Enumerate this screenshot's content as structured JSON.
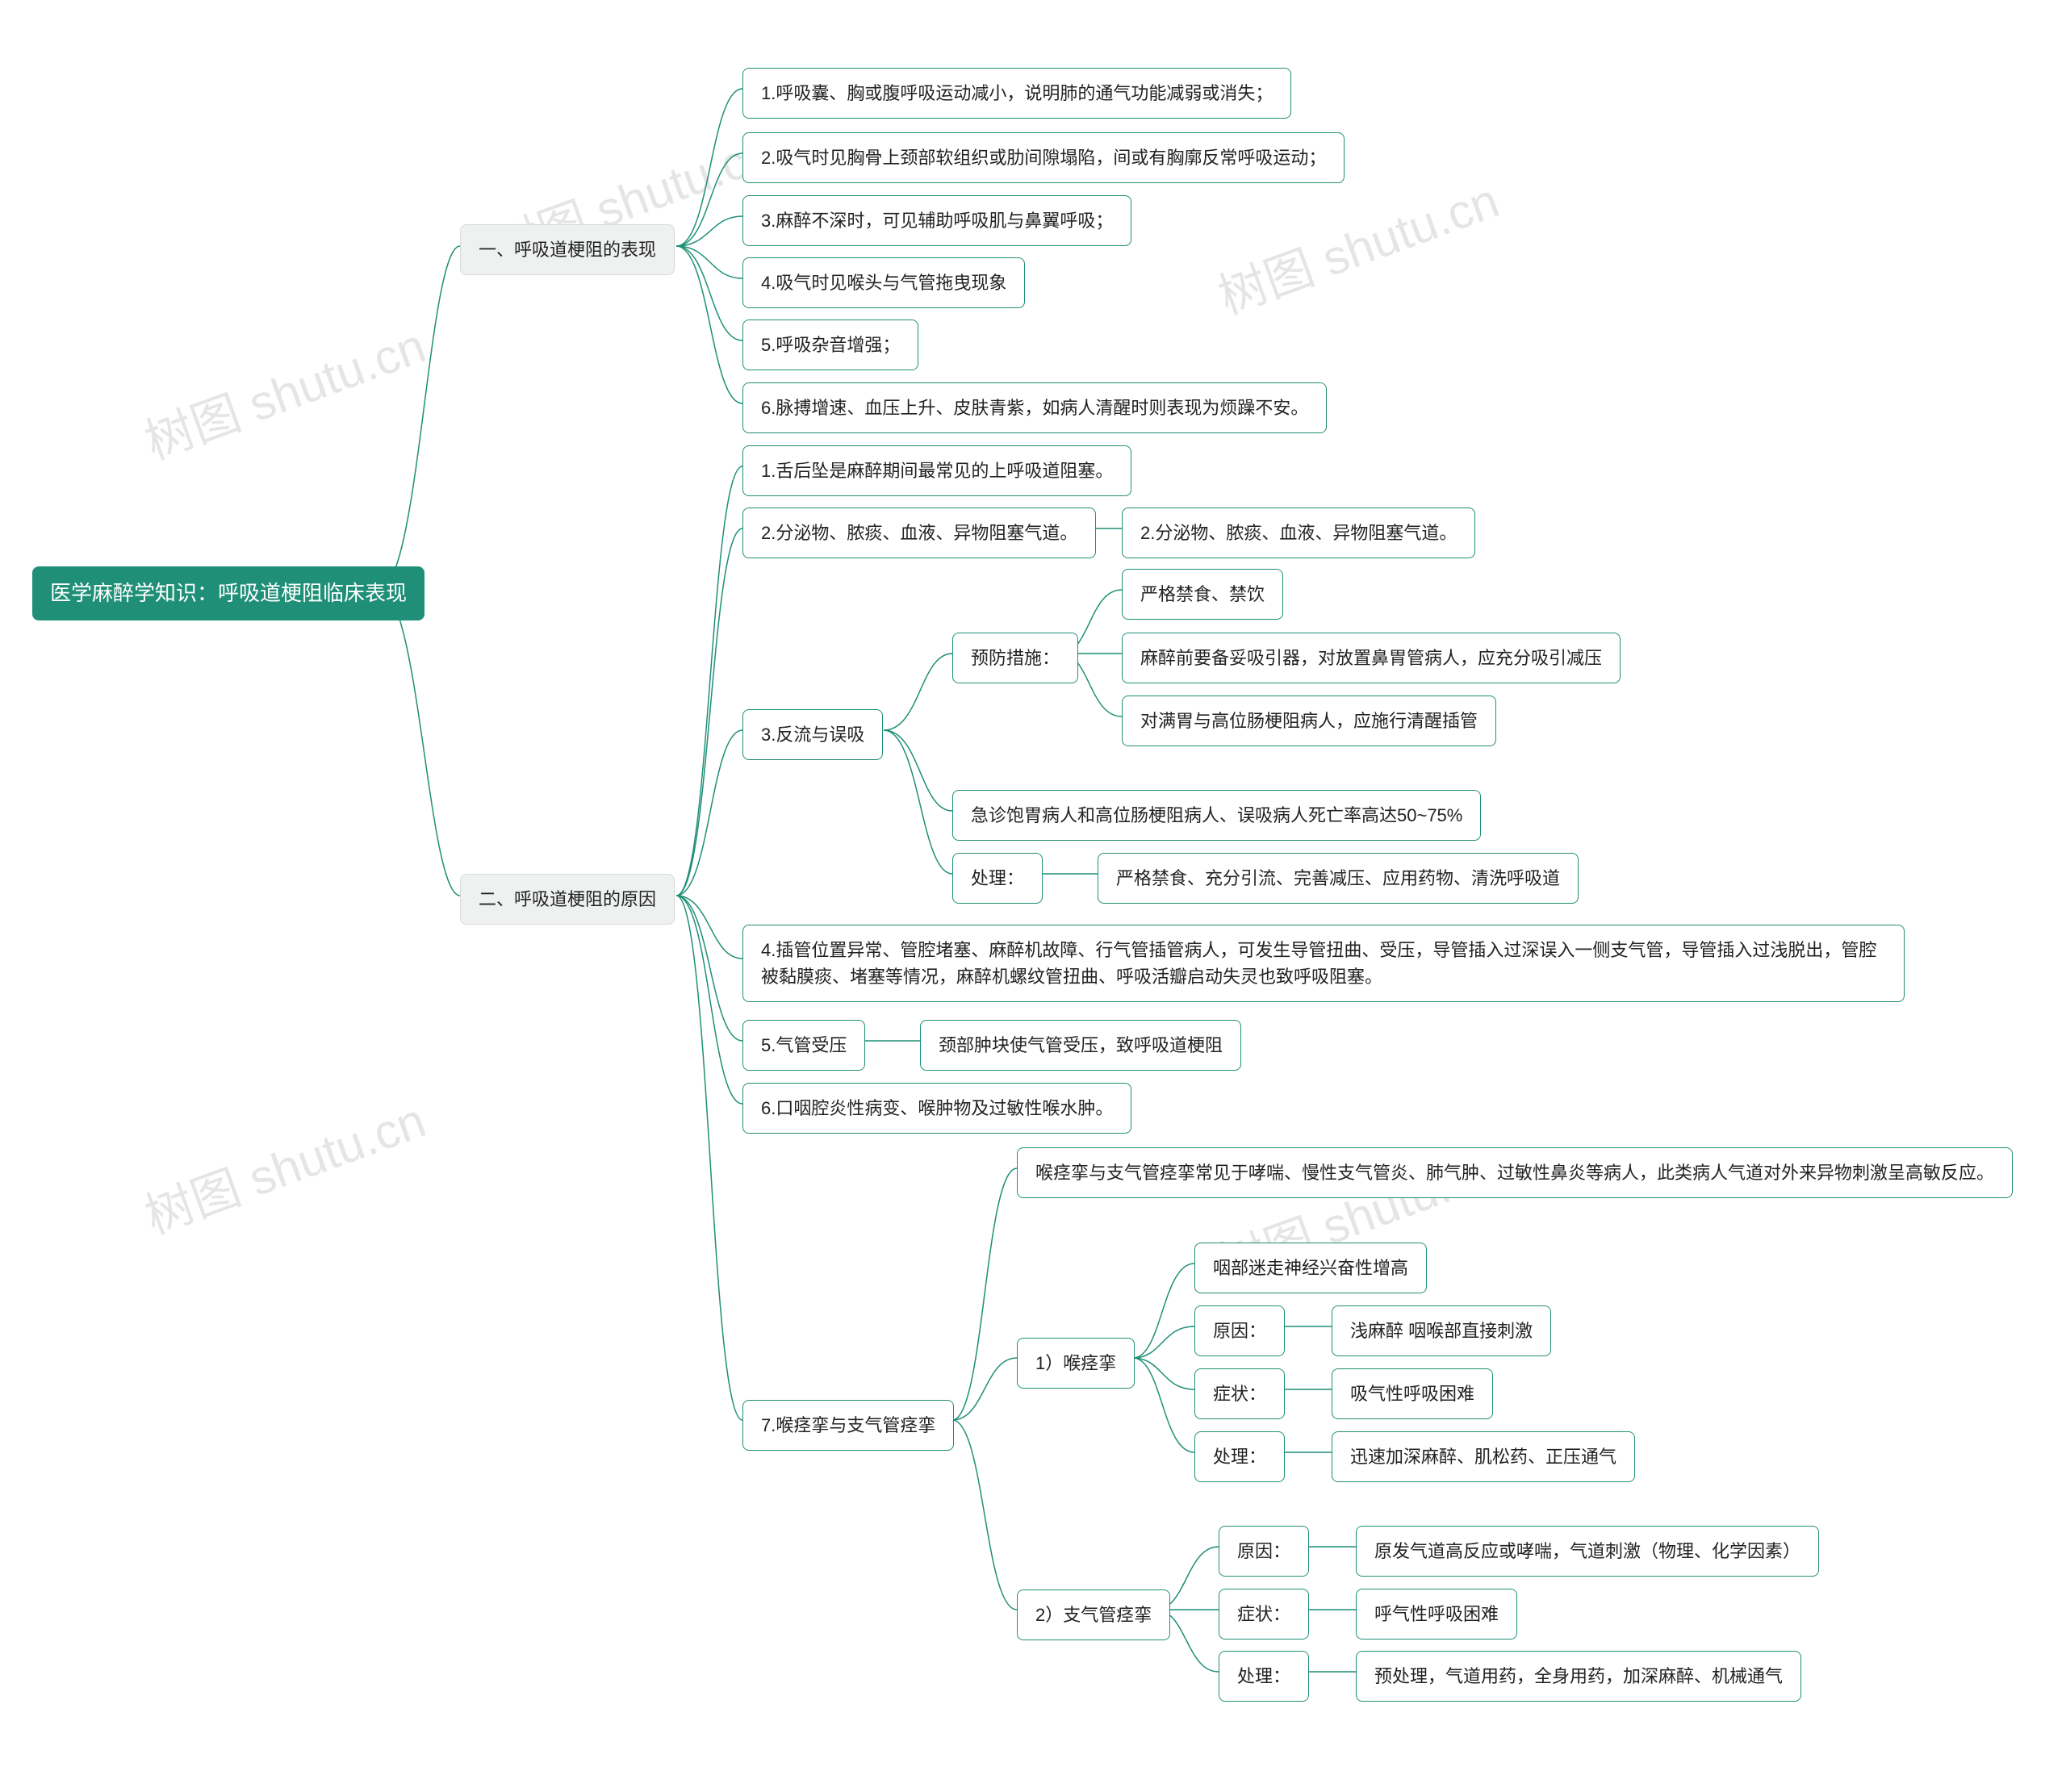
{
  "root": "医学麻醉学知识：呼吸道梗阻临床表现",
  "section1": {
    "title": "一、呼吸道梗阻的表现",
    "items": [
      "1.呼吸囊、胸或腹呼吸运动减小，说明肺的通气功能减弱或消失；",
      "2.吸气时见胸骨上颈部软组织或肋间隙塌陷，间或有胸廓反常呼吸运动；",
      "3.麻醉不深时，可见辅助呼吸肌与鼻翼呼吸；",
      "4.吸气时见喉头与气管拖曳现象",
      "5.呼吸杂音增强；",
      "6.脉搏增速、血压上升、皮肤青紫，如病人清醒时则表现为烦躁不安。"
    ]
  },
  "section2": {
    "title": "二、呼吸道梗阻的原因",
    "item1": "1.舌后坠是麻醉期间最常见的上呼吸道阻塞。",
    "item2": {
      "label": "2.分泌物、脓痰、血液、异物阻塞气道。",
      "sub": "2.分泌物、脓痰、血液、异物阻塞气道。"
    },
    "item3": {
      "label": "3.反流与误吸",
      "prevent": {
        "label": "预防措施：",
        "a": "严格禁食、禁饮",
        "b": "麻醉前要备妥吸引器，对放置鼻胃管病人，应充分吸引减压",
        "c": "对满胃与高位肠梗阻病人，应施行清醒插管"
      },
      "note": "急诊饱胃病人和高位肠梗阻病人、误吸病人死亡率高达50~75%",
      "handle": {
        "label": "处理：",
        "text": "严格禁食、充分引流、完善减压、应用药物、清洗呼吸道"
      }
    },
    "item4": "4.插管位置异常、管腔堵塞、麻醉机故障、行气管插管病人，可发生导管扭曲、受压，导管插入过深误入一侧支气管，导管插入过浅脱出，管腔被黏膜痰、堵塞等情况，麻醉机螺纹管扭曲、呼吸活瓣启动失灵也致呼吸阻塞。",
    "item5": {
      "label": "5.气管受压",
      "sub": "颈部肿块使气管受压，致呼吸道梗阻"
    },
    "item6": "6.口咽腔炎性病变、喉肿物及过敏性喉水肿。",
    "item7": {
      "label": "7.喉痉挛与支气管痉挛",
      "intro": "喉痉挛与支气管痉挛常见于哮喘、慢性支气管炎、肺气肿、过敏性鼻炎等病人，此类病人气道对外来异物刺激呈高敏反应。",
      "laryngo": {
        "label": "1）喉痉挛",
        "vagus": "咽部迷走神经兴奋性增高",
        "cause": {
          "label": "原因：",
          "text": "浅麻醉 咽喉部直接刺激"
        },
        "symptom": {
          "label": "症状：",
          "text": "吸气性呼吸困难"
        },
        "handle": {
          "label": "处理：",
          "text": "迅速加深麻醉、肌松药、正压通气"
        }
      },
      "broncho": {
        "label": "2）支气管痉挛",
        "cause": {
          "label": "原因：",
          "text": "原发气道高反应或哮喘，气道刺激（物理、化学因素）"
        },
        "symptom": {
          "label": "症状：",
          "text": "呼气性呼吸困难"
        },
        "handle": {
          "label": "处理：",
          "text": "预处理，气道用药，全身用药，加深麻醉、机械通气"
        }
      }
    }
  },
  "watermark": "树图 shutu.cn"
}
